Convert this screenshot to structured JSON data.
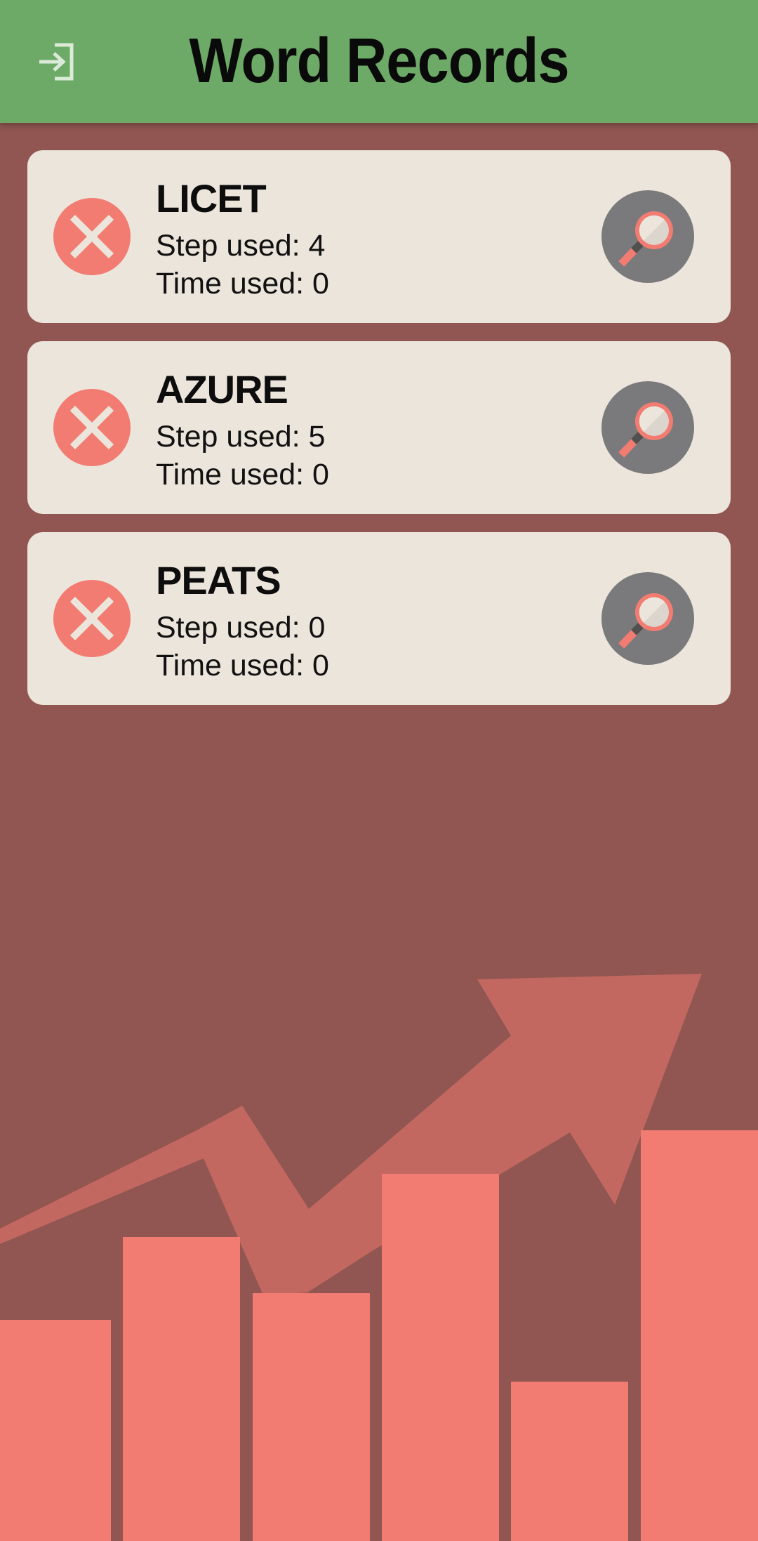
{
  "appbar": {
    "title": "Word Records",
    "login_icon": "login-icon"
  },
  "colors": {
    "appbar": "#6DAA67",
    "background": "#915651",
    "card": "#ECE5DC",
    "delete_button": "#F27C72",
    "view_button": "#7A7A7C",
    "bars": "#F27C72",
    "arrow": "#C26860"
  },
  "records": [
    {
      "word": "LICET",
      "steps": "Step used: 4",
      "time": "Time used: 0",
      "delete_icon": "close-icon",
      "view_icon": "magnifier-icon"
    },
    {
      "word": "AZURE",
      "steps": "Step used: 5",
      "time": "Time used: 0",
      "delete_icon": "close-icon",
      "view_icon": "magnifier-icon"
    },
    {
      "word": "PEATS",
      "steps": "Step used: 0",
      "time": "Time used: 0",
      "delete_icon": "close-icon",
      "view_icon": "magnifier-icon"
    }
  ]
}
